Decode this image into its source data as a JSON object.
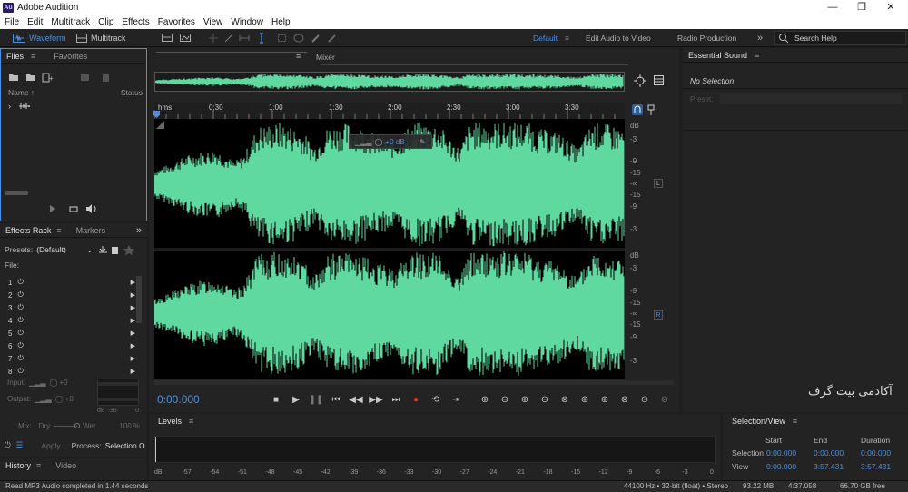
{
  "window": {
    "app_logo": "Au",
    "title": "Adobe Audition",
    "minimize": "—",
    "maximize": "❐",
    "close": "✕"
  },
  "menu": [
    "File",
    "Edit",
    "Multitrack",
    "Clip",
    "Effects",
    "Favorites",
    "View",
    "Window",
    "Help"
  ],
  "toolbar": {
    "waveform_label": "Waveform",
    "multitrack_label": "Multitrack",
    "workspaces": [
      "Default",
      "Edit Audio to Video",
      "Radio Production"
    ],
    "search_placeholder": "Search Help",
    "more": "»"
  },
  "files_panel": {
    "tabs": [
      "Files",
      "Favorites"
    ],
    "col_name": "Name",
    "col_status": "Status"
  },
  "effects_panel": {
    "tabs": [
      "Effects Rack",
      "Markers"
    ],
    "presets_label": "Presets:",
    "presets_value": "(Default)",
    "file_label": "File:",
    "slots": [
      "1",
      "2",
      "3",
      "4",
      "5",
      "6",
      "7",
      "8"
    ],
    "input_label": "Input:",
    "output_label": "Output:",
    "input_db": "+0",
    "output_db": "+0",
    "db_label": "dB",
    "db_min": "-36",
    "db_zero": "0",
    "mix_label": "Mix:",
    "dry_label": "Dry",
    "wet_label": "Wet",
    "mix_value": "100 %",
    "apply_label": "Apply",
    "process_label": "Process:",
    "process_value": "Selection O"
  },
  "history_panel": {
    "tabs": [
      "History",
      "Video"
    ]
  },
  "editor": {
    "mixer_label": "Mixer",
    "timeline_unit": "hms",
    "timeline_ticks": [
      "0:30",
      "1:00",
      "1:30",
      "2:00",
      "2:30",
      "3:00",
      "3:30"
    ],
    "hud_gain": "+0 dB",
    "db_ticks_top": [
      "dB",
      "-3",
      "-9",
      "-15",
      "-∞",
      "-15",
      "-9",
      "-3"
    ],
    "db_ticks_bottom": [
      "dB",
      "-3",
      "-9",
      "-15",
      "-∞",
      "-15",
      "-9",
      "-3"
    ],
    "channel_left": "L",
    "channel_right": "R",
    "timecode": "0:00.000"
  },
  "essential_panel": {
    "title": "Essential Sound",
    "no_selection": "No Selection",
    "preset_label": "Preset:"
  },
  "levels_panel": {
    "title": "Levels",
    "scale": [
      "dB",
      "-57",
      "-54",
      "-51",
      "-48",
      "-45",
      "-42",
      "-39",
      "-36",
      "-33",
      "-30",
      "-27",
      "-24",
      "-21",
      "-18",
      "-15",
      "-12",
      "-9",
      "-6",
      "-3",
      "0"
    ]
  },
  "selview_panel": {
    "title": "Selection/View",
    "headers": [
      "Start",
      "End",
      "Duration"
    ],
    "rows": [
      {
        "label": "Selection",
        "start": "0:00.000",
        "end": "0:00.000",
        "duration": "0:00.000"
      },
      {
        "label": "View",
        "start": "0:00.000",
        "end": "3:57.431",
        "duration": "3:57.431"
      }
    ]
  },
  "status": {
    "message": "Read MP3 Audio completed in 1.44 seconds",
    "format": "44100 Hz • 32-bit (float) • Stereo",
    "size": "93.22 MB",
    "duration": "4:37.058",
    "free": "66.70 GB free"
  },
  "watermark": "آکادمی بیت گرف",
  "colors": {
    "accent": "#4d8fe0",
    "waveform": "#5fd9a0",
    "record": "#e0352b"
  }
}
